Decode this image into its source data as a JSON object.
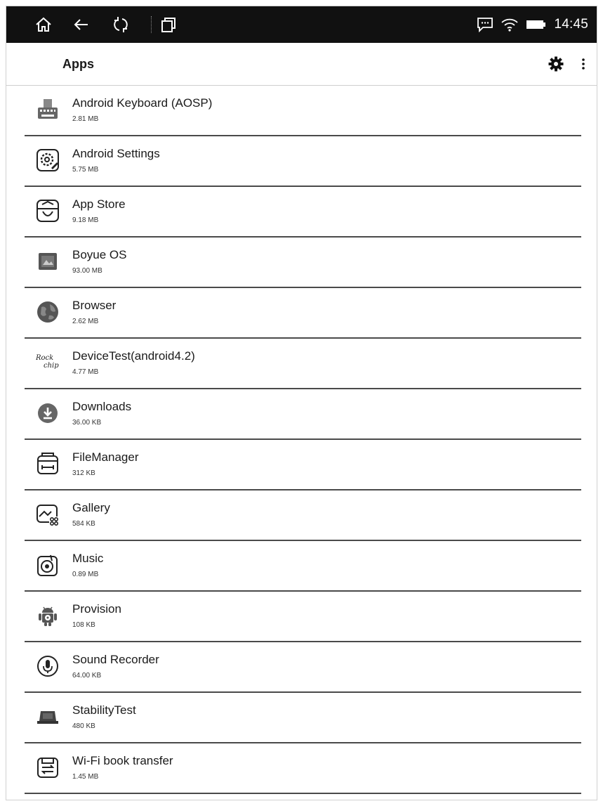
{
  "status_bar": {
    "icons": [
      "home-icon",
      "back-icon",
      "refresh-icon",
      "multitask-icon"
    ],
    "right_icons": [
      "message-icon",
      "wifi-icon",
      "battery-icon"
    ],
    "time": "14:45"
  },
  "appbar": {
    "title": "Apps",
    "settings_icon": "gear-icon",
    "menu_icon": "more-vert-icon"
  },
  "apps": [
    {
      "name": "Android Keyboard (AOSP)",
      "size": "2.81 MB",
      "icon": "keyboard-icon"
    },
    {
      "name": "Android Settings",
      "size": "5.75 MB",
      "icon": "settings-icon"
    },
    {
      "name": "App Store",
      "size": "9.18 MB",
      "icon": "app-store-icon"
    },
    {
      "name": "Boyue OS",
      "size": "93.00 MB",
      "icon": "boyue-os-icon"
    },
    {
      "name": "Browser",
      "size": "2.62 MB",
      "icon": "globe-icon"
    },
    {
      "name": "DeviceTest(android4.2)",
      "size": "4.77 MB",
      "icon": "rockchip-icon",
      "icon_text": "Rock chip"
    },
    {
      "name": "Downloads",
      "size": "36.00 KB",
      "icon": "download-icon"
    },
    {
      "name": "FileManager",
      "size": "312 KB",
      "icon": "folder-icon"
    },
    {
      "name": "Gallery",
      "size": "584 KB",
      "icon": "gallery-icon"
    },
    {
      "name": "Music",
      "size": "0.89 MB",
      "icon": "music-icon"
    },
    {
      "name": "Provision",
      "size": "108 KB",
      "icon": "android-icon"
    },
    {
      "name": "Sound Recorder",
      "size": "64.00 KB",
      "icon": "microphone-icon"
    },
    {
      "name": "StabilityTest",
      "size": "480 KB",
      "icon": "laptop-icon"
    },
    {
      "name": "Wi-Fi book transfer",
      "size": "1.45 MB",
      "icon": "book-transfer-icon"
    }
  ]
}
